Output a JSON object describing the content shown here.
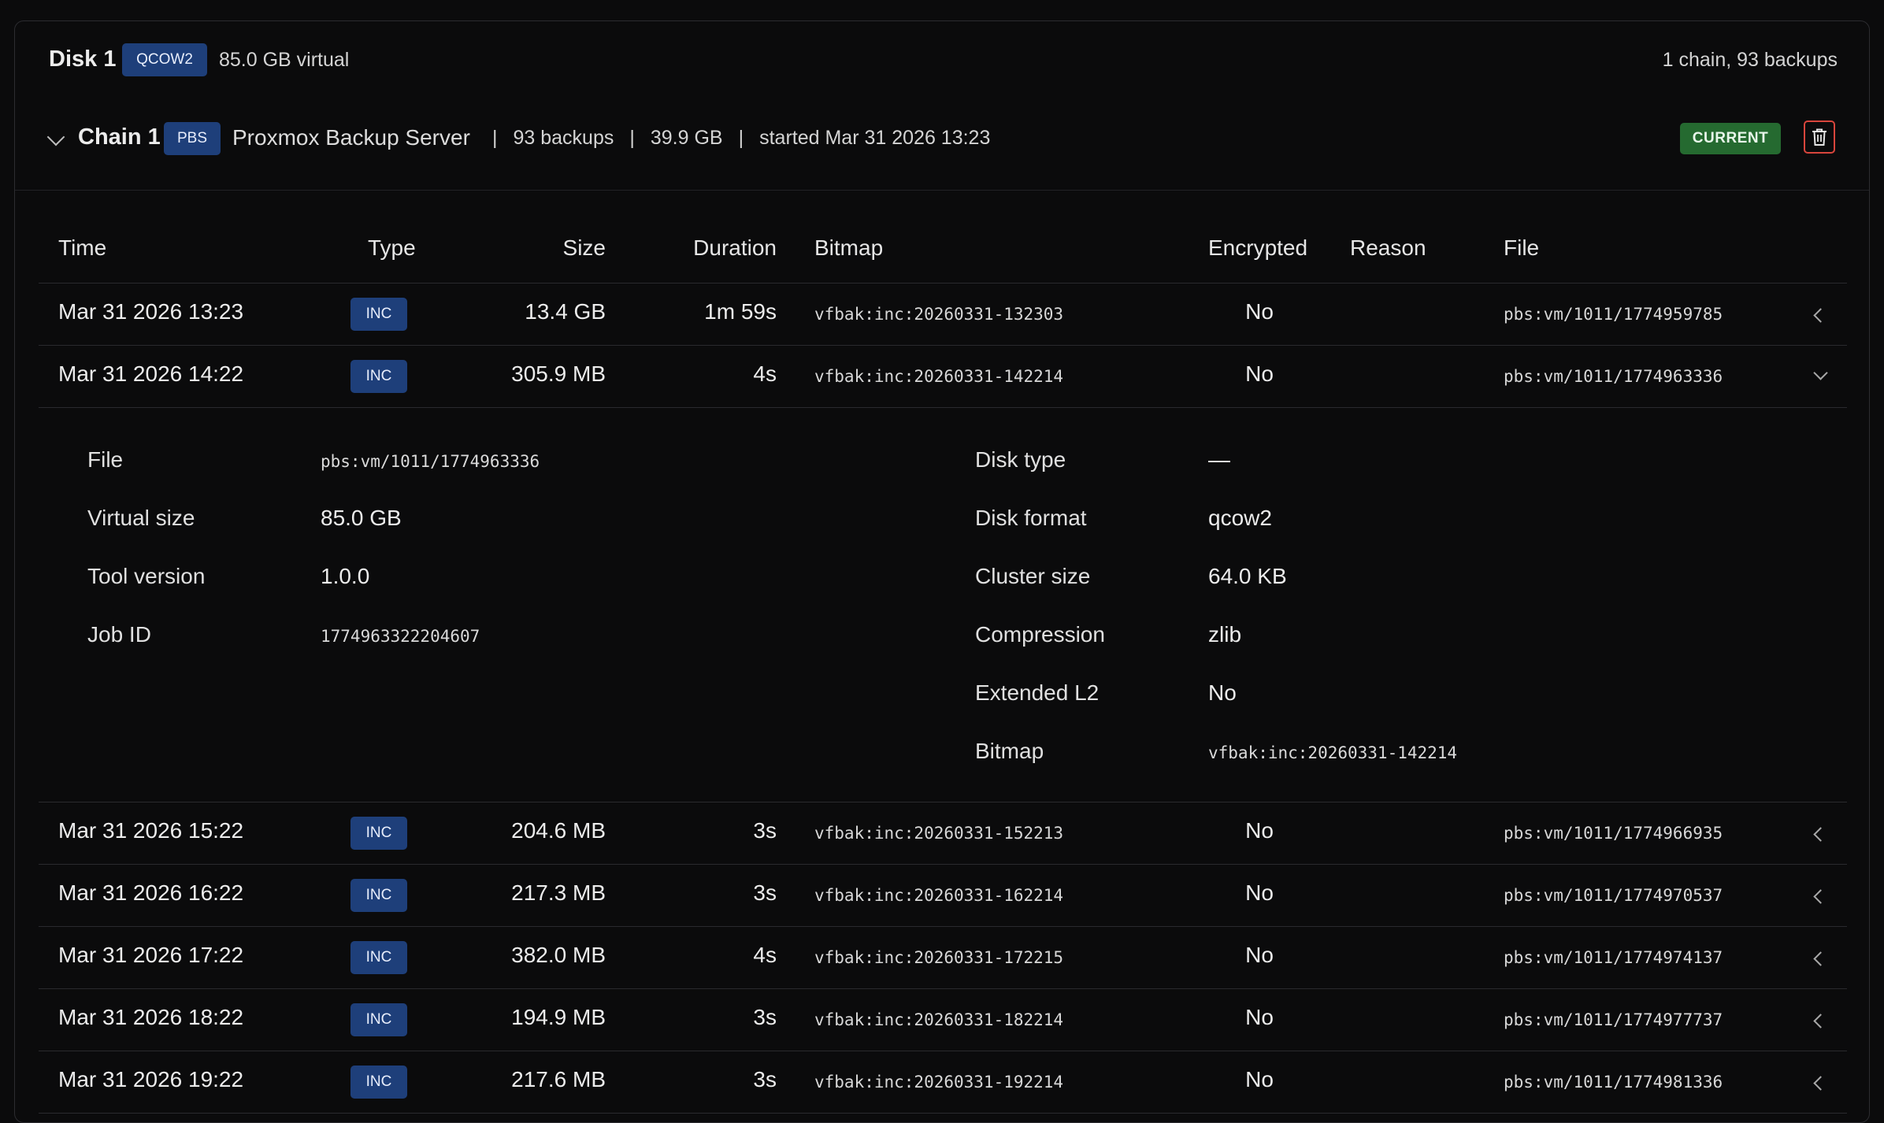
{
  "disk": {
    "title": "Disk 1",
    "format_badge": "QCOW2",
    "virtual": "85.0 GB virtual",
    "summary": "1 chain, 93 backups"
  },
  "chain": {
    "title": "Chain 1",
    "type_badge": "PBS",
    "server": "Proxmox Backup Server",
    "separator": "|",
    "backups": "93 backups",
    "size": "39.9 GB",
    "started": "started Mar 31 2026 13:23",
    "status_badge": "CURRENT"
  },
  "columns": {
    "time": "Time",
    "type": "Type",
    "size": "Size",
    "duration": "Duration",
    "bitmap": "Bitmap",
    "encrypted": "Encrypted",
    "reason": "Reason",
    "file": "File"
  },
  "rows": [
    {
      "time": "Mar 31 2026 13:23",
      "type": "INC",
      "size": "13.4 GB",
      "duration": "1m 59s",
      "bitmap": "vfbak:inc:20260331-132303",
      "encrypted": "No",
      "reason": "",
      "file": "pbs:vm/1011/1774959785"
    },
    {
      "time": "Mar 31 2026 14:22",
      "type": "INC",
      "size": "305.9 MB",
      "duration": "4s",
      "bitmap": "vfbak:inc:20260331-142214",
      "encrypted": "No",
      "reason": "",
      "file": "pbs:vm/1011/1774963336"
    },
    {
      "time": "Mar 31 2026 15:22",
      "type": "INC",
      "size": "204.6 MB",
      "duration": "3s",
      "bitmap": "vfbak:inc:20260331-152213",
      "encrypted": "No",
      "reason": "",
      "file": "pbs:vm/1011/1774966935"
    },
    {
      "time": "Mar 31 2026 16:22",
      "type": "INC",
      "size": "217.3 MB",
      "duration": "3s",
      "bitmap": "vfbak:inc:20260331-162214",
      "encrypted": "No",
      "reason": "",
      "file": "pbs:vm/1011/1774970537"
    },
    {
      "time": "Mar 31 2026 17:22",
      "type": "INC",
      "size": "382.0 MB",
      "duration": "4s",
      "bitmap": "vfbak:inc:20260331-172215",
      "encrypted": "No",
      "reason": "",
      "file": "pbs:vm/1011/1774974137"
    },
    {
      "time": "Mar 31 2026 18:22",
      "type": "INC",
      "size": "194.9 MB",
      "duration": "3s",
      "bitmap": "vfbak:inc:20260331-182214",
      "encrypted": "No",
      "reason": "",
      "file": "pbs:vm/1011/1774977737"
    },
    {
      "time": "Mar 31 2026 19:22",
      "type": "INC",
      "size": "217.6 MB",
      "duration": "3s",
      "bitmap": "vfbak:inc:20260331-192214",
      "encrypted": "No",
      "reason": "",
      "file": "pbs:vm/1011/1774981336"
    }
  ],
  "details": {
    "left": [
      {
        "label": "File",
        "value": "pbs:vm/1011/1774963336"
      },
      {
        "label": "Virtual size",
        "value": "85.0 GB"
      },
      {
        "label": "Tool version",
        "value": "1.0.0"
      },
      {
        "label": "Job ID",
        "value": "1774963322204607"
      }
    ],
    "right": [
      {
        "label": "Disk type",
        "value": "—"
      },
      {
        "label": "Disk format",
        "value": "qcow2"
      },
      {
        "label": "Cluster size",
        "value": "64.0 KB"
      },
      {
        "label": "Compression",
        "value": "zlib"
      },
      {
        "label": "Extended L2",
        "value": "No"
      },
      {
        "label": "Bitmap",
        "value": "vfbak:inc:20260331-142214"
      }
    ]
  },
  "icons": {
    "chain_toggle": "chevron-down-icon",
    "delete": "trash-icon",
    "row_collapsed": "chevron-left-icon",
    "row_expanded": "chevron-down-icon"
  },
  "colors": {
    "background": "#0b0b0c",
    "badge_blue": "#1e3f7a",
    "current_green": "#256a30",
    "delete_red": "#d8453c"
  }
}
